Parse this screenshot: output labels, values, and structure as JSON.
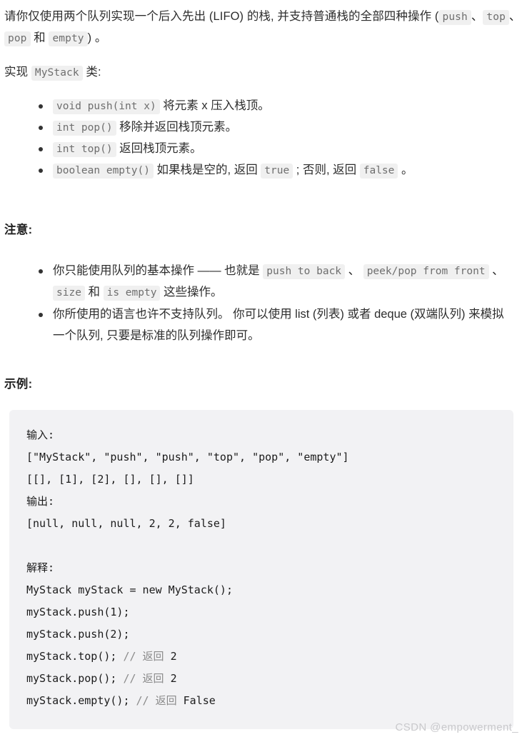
{
  "problem": {
    "intro_1": "请你仅使用两个队列实现一个后入先出 (LIFO) 的栈, 并支持普通栈的全部四种操作 (",
    "intro_codes": [
      "push",
      "top",
      "pop",
      "empty"
    ],
    "intro_sep_1": "、",
    "intro_sep_2": "、",
    "intro_and": " 和 ",
    "intro_tail": ") 。",
    "implement_prefix": "实现 ",
    "implement_class": "MyStack",
    "implement_suffix": " 类:"
  },
  "methods": [
    {
      "code": "void push(int x)",
      "desc": " 将元素 x 压入栈顶。"
    },
    {
      "code": "int pop()",
      "desc": " 移除并返回栈顶元素。"
    },
    {
      "code": "int top()",
      "desc": " 返回栈顶元素。"
    },
    {
      "code": "boolean empty()",
      "desc_a": " 如果栈是空的, 返回 ",
      "true_code": "true",
      "desc_b": " ; 否则, 返回 ",
      "false_code": "false",
      "desc_c": " 。"
    }
  ],
  "note": {
    "heading": "注意:",
    "item1": {
      "text_a": "你只能使用队列的基本操作 —— 也就是 ",
      "code_a": "push to back",
      "sep_a": " 、 ",
      "code_b": "peek/pop from front",
      "sep_b": " 、 ",
      "code_c": "size",
      "and": " 和 ",
      "code_d": "is empty",
      "text_b": " 这些操作。"
    },
    "item2": "你所使用的语言也许不支持队列。 你可以使用 list (列表) 或者 deque (双端队列) 来模拟一个队列, 只要是标准的队列操作即可。"
  },
  "example": {
    "heading": "示例:",
    "input_label": "输入:",
    "input_line_1": "[\"MyStack\", \"push\", \"push\", \"top\", \"pop\", \"empty\"]",
    "input_line_2": "[[], [1], [2], [], [], []]",
    "output_label": "输出:",
    "output_line": "[null, null, null, 2, 2, false]",
    "explain_label": "解释:",
    "code_lines": [
      "MyStack myStack = new MyStack();",
      "myStack.push(1);",
      "myStack.push(2);"
    ],
    "line_top_code": "myStack.top(); ",
    "line_top_comment": "// 返回 ",
    "line_top_value": "2",
    "line_pop_code": "myStack.pop(); ",
    "line_pop_comment": "// 返回 ",
    "line_pop_value": "2",
    "line_empty_code": "myStack.empty(); ",
    "line_empty_comment": "// 返回 ",
    "line_empty_value": "False"
  },
  "watermark": "CSDN @empowerment_",
  "colors": {
    "code_block_bg": "#f2f2f4",
    "inline_code_bg": "#f0f0f0",
    "inline_code_fg": "#6e6e6e",
    "text": "#2d2d2d",
    "comment": "#8b8b8b",
    "watermark": "#c9c9cc"
  }
}
